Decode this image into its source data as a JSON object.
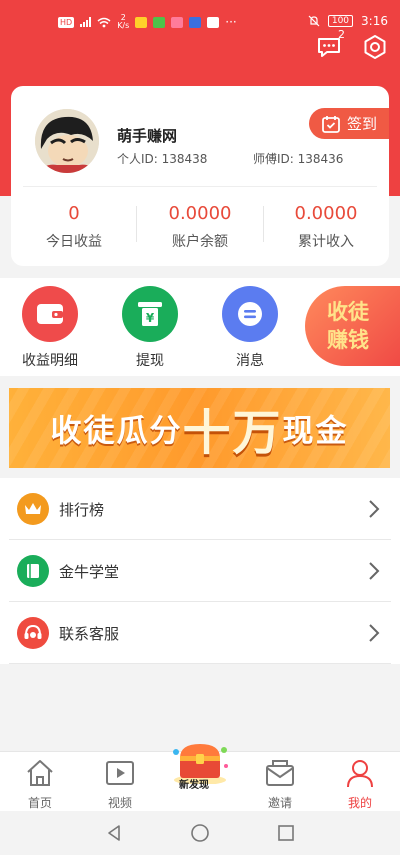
{
  "status_bar": {
    "speed_value": "2",
    "speed_unit": "K/s",
    "battery": "100",
    "time": "3:16"
  },
  "header": {
    "message_badge": "2",
    "icons": [
      "message-icon",
      "settings-icon"
    ]
  },
  "profile": {
    "nickname": "萌手赚网",
    "user_id": "个人ID: 138438",
    "master_id": "师傅ID: 138436",
    "checkin_label": "签到"
  },
  "stats": [
    {
      "value": "0",
      "label": "今日收益"
    },
    {
      "value": "0.0000",
      "label": "账户余额"
    },
    {
      "value": "0.0000",
      "label": "累计收入"
    }
  ],
  "actions": [
    {
      "label": "收益明细",
      "icon": "wallet-icon",
      "color": "#ef4b4b"
    },
    {
      "label": "提现",
      "icon": "withdraw-icon",
      "color": "#1aad5a"
    },
    {
      "label": "消息",
      "icon": "message-bubble-icon",
      "color": "#5b7cf0"
    }
  ],
  "recruit": {
    "line1": "收徒",
    "line2": "赚钱"
  },
  "banner": {
    "part1": "收徒瓜分",
    "part2": "十万",
    "part3": "现金"
  },
  "menu": [
    {
      "label": "排行榜",
      "icon": "crown-icon",
      "color": "#f39a1e"
    },
    {
      "label": "金牛学堂",
      "icon": "book-icon",
      "color": "#1aad5a"
    },
    {
      "label": "联系客服",
      "icon": "headset-icon",
      "color": "#ef4b3f"
    }
  ],
  "bottom_nav": {
    "home": "首页",
    "video": "视频",
    "discover": "新发现",
    "invite": "邀请",
    "mine": "我的"
  },
  "colors": {
    "primary": "#ee4141",
    "stat_value": "#e84a3a",
    "banner": "#ff9a2c"
  }
}
